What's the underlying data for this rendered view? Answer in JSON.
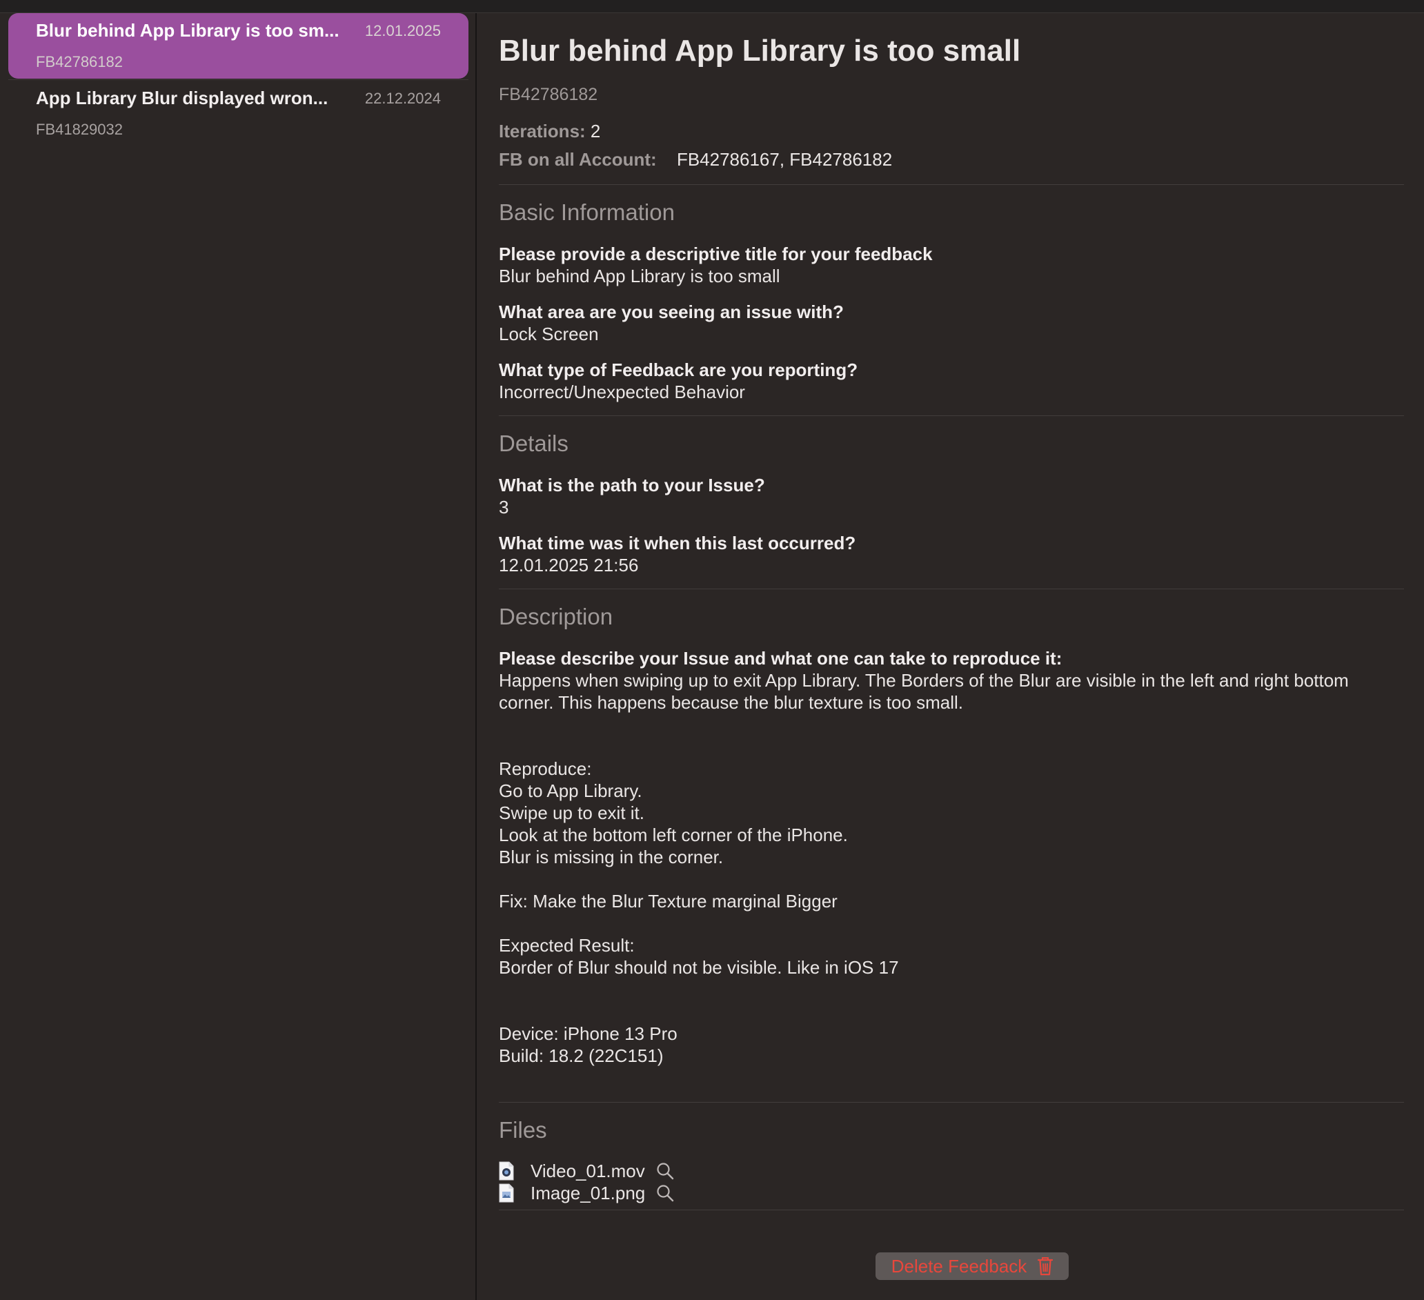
{
  "sidebar": {
    "items": [
      {
        "title": "Blur behind App Library is too sm...",
        "date": "12.01.2025",
        "id": "FB42786182",
        "selected": true
      },
      {
        "title": "App Library Blur displayed wron...",
        "date": "22.12.2024",
        "id": "FB41829032",
        "selected": false
      }
    ]
  },
  "detail": {
    "title": "Blur behind App Library is too small",
    "id": "FB42786182",
    "iterations_label": "Iterations:",
    "iterations_value": "2",
    "fb_account_label": "FB on all Account:",
    "fb_account_value": "FB42786167, FB42786182"
  },
  "basic_info": {
    "heading": "Basic Information",
    "fields": [
      {
        "question": "Please provide a descriptive title for your feedback",
        "answer": "Blur behind App Library is too small"
      },
      {
        "question": "What area are you seeing an issue with?",
        "answer": "Lock Screen"
      },
      {
        "question": "What type of Feedback are you reporting?",
        "answer": "Incorrect/Unexpected Behavior"
      }
    ]
  },
  "details": {
    "heading": "Details",
    "fields": [
      {
        "question": "What is the path to your Issue?",
        "answer": "3"
      },
      {
        "question": "What time was it when this last occurred?",
        "answer": "12.01.2025 21:56"
      }
    ]
  },
  "description": {
    "heading": "Description",
    "question": "Please describe your Issue and what one can take to reproduce it:",
    "answer": "Happens when swiping up to exit App Library. The Borders of the Blur are visible in the left and right bottom corner. This happens because the blur texture is too small.\n\n\nReproduce:\nGo to App Library.\nSwipe up to exit it.\nLook at the bottom left corner of the iPhone.\nBlur is missing in the corner.\n\nFix: Make the Blur Texture marginal Bigger\n\nExpected Result:\nBorder of Blur should not be visible. Like in iOS 17\n\n\nDevice: iPhone 13 Pro\nBuild: 18.2 (22C151)"
  },
  "files": {
    "heading": "Files",
    "items": [
      {
        "name": "Video_01.mov",
        "icon": "video-file-icon"
      },
      {
        "name": "Image_01.png",
        "icon": "image-file-icon"
      }
    ]
  },
  "actions": {
    "delete_label": "Delete Feedback",
    "delete_color": "#e8473c"
  },
  "colors": {
    "accent_selected": "#9a4f9e",
    "background": "#2b2625"
  }
}
